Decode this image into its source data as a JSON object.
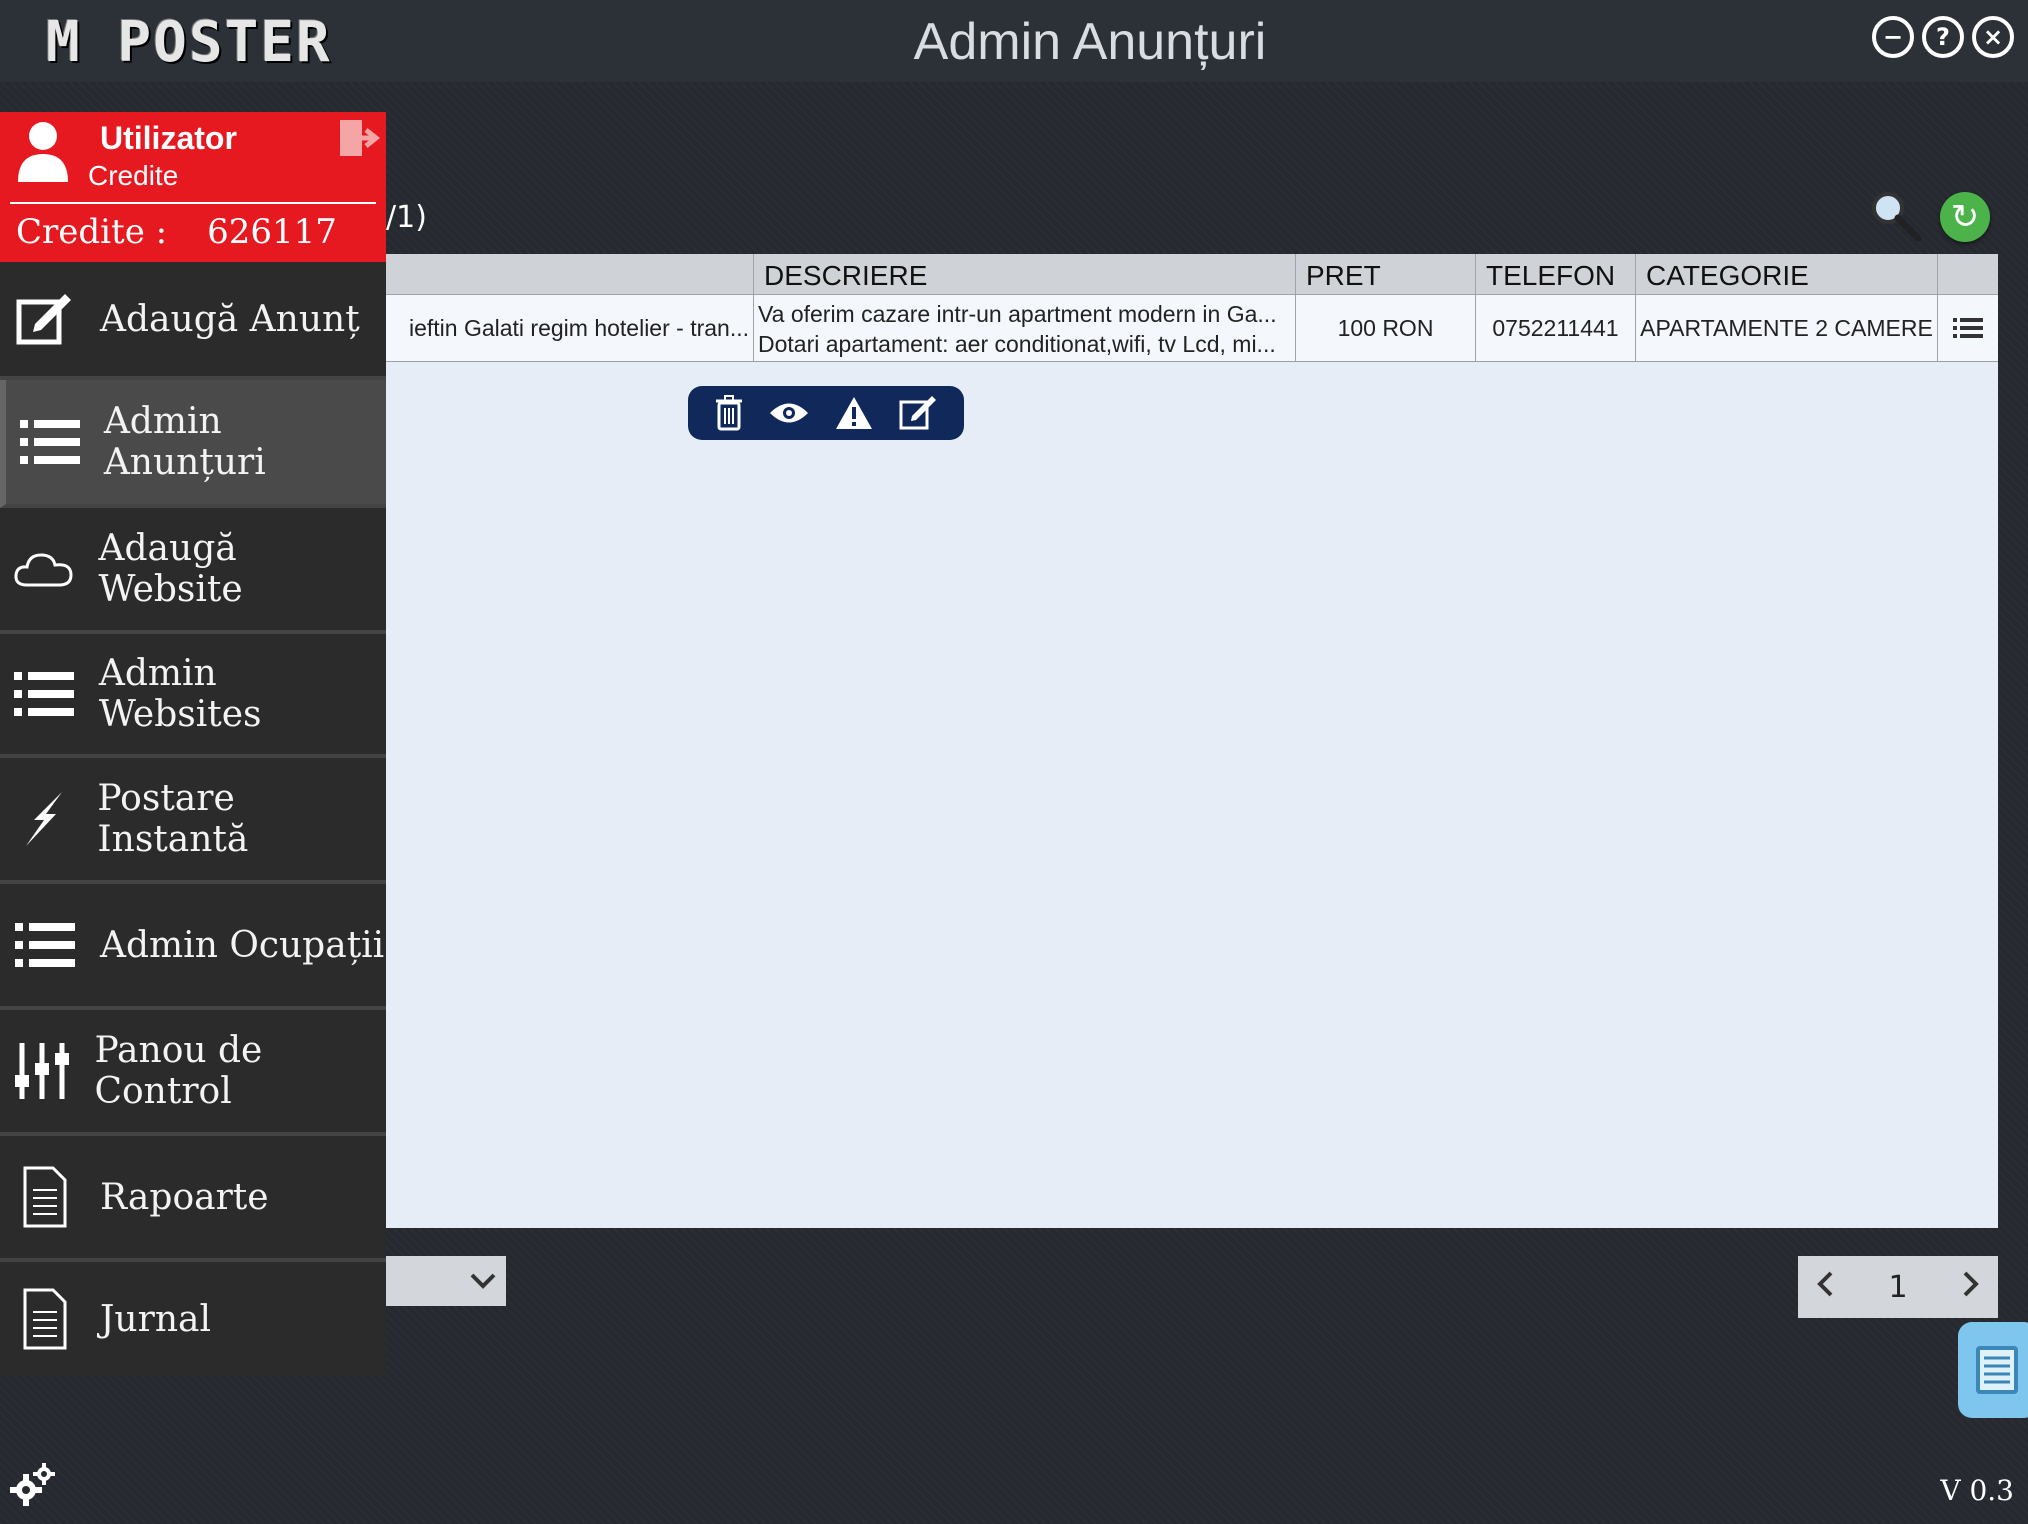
{
  "app": {
    "logo": "M POSTER",
    "title": "Admin Anunțuri",
    "version": "V 0.3"
  },
  "window_controls": [
    {
      "name": "minimize",
      "glyph": "−"
    },
    {
      "name": "help",
      "glyph": "?"
    },
    {
      "name": "close",
      "glyph": "×"
    }
  ],
  "user": {
    "name": "Utilizator",
    "subtitle": "Credite",
    "credits_label": "Credite :",
    "credits_value": "626117"
  },
  "nav": [
    {
      "label": "Adaugă Anunț",
      "icon": "edit-icon"
    },
    {
      "label": "Admin Anunțuri",
      "icon": "list-icon",
      "active": true
    },
    {
      "label": "Adaugă Website",
      "icon": "cloud-icon"
    },
    {
      "label": "Admin Websites",
      "icon": "list-icon"
    },
    {
      "label": "Postare Instantă",
      "icon": "lightning-icon"
    },
    {
      "label": "Admin Ocupații",
      "icon": "list-icon"
    },
    {
      "label": "Panou de Control",
      "icon": "sliders-icon"
    },
    {
      "label": "Rapoarte",
      "icon": "document-icon"
    },
    {
      "label": "Jurnal",
      "icon": "document-icon"
    }
  ],
  "main": {
    "count_label": "/1)",
    "table": {
      "headers": [
        "DESCRIERE",
        "PRET",
        "TELEFON",
        "CATEGORIE"
      ],
      "row": {
        "title": "ieftin Galati regim hotelier - tran...",
        "description_line1": "Va oferim cazare intr-un apartment modern in Ga...",
        "description_line2": "Dotari apartament: aer conditionat,wifi, tv Lcd, mi...",
        "price": "100 RON",
        "phone": "0752211441",
        "category": "APARTAMENTE 2 CAMERE"
      }
    },
    "pager": {
      "page": "1"
    }
  },
  "colors": {
    "accent_red": "#e5191f",
    "action_bar": "#10285a",
    "refresh_green": "#4cb34a"
  }
}
